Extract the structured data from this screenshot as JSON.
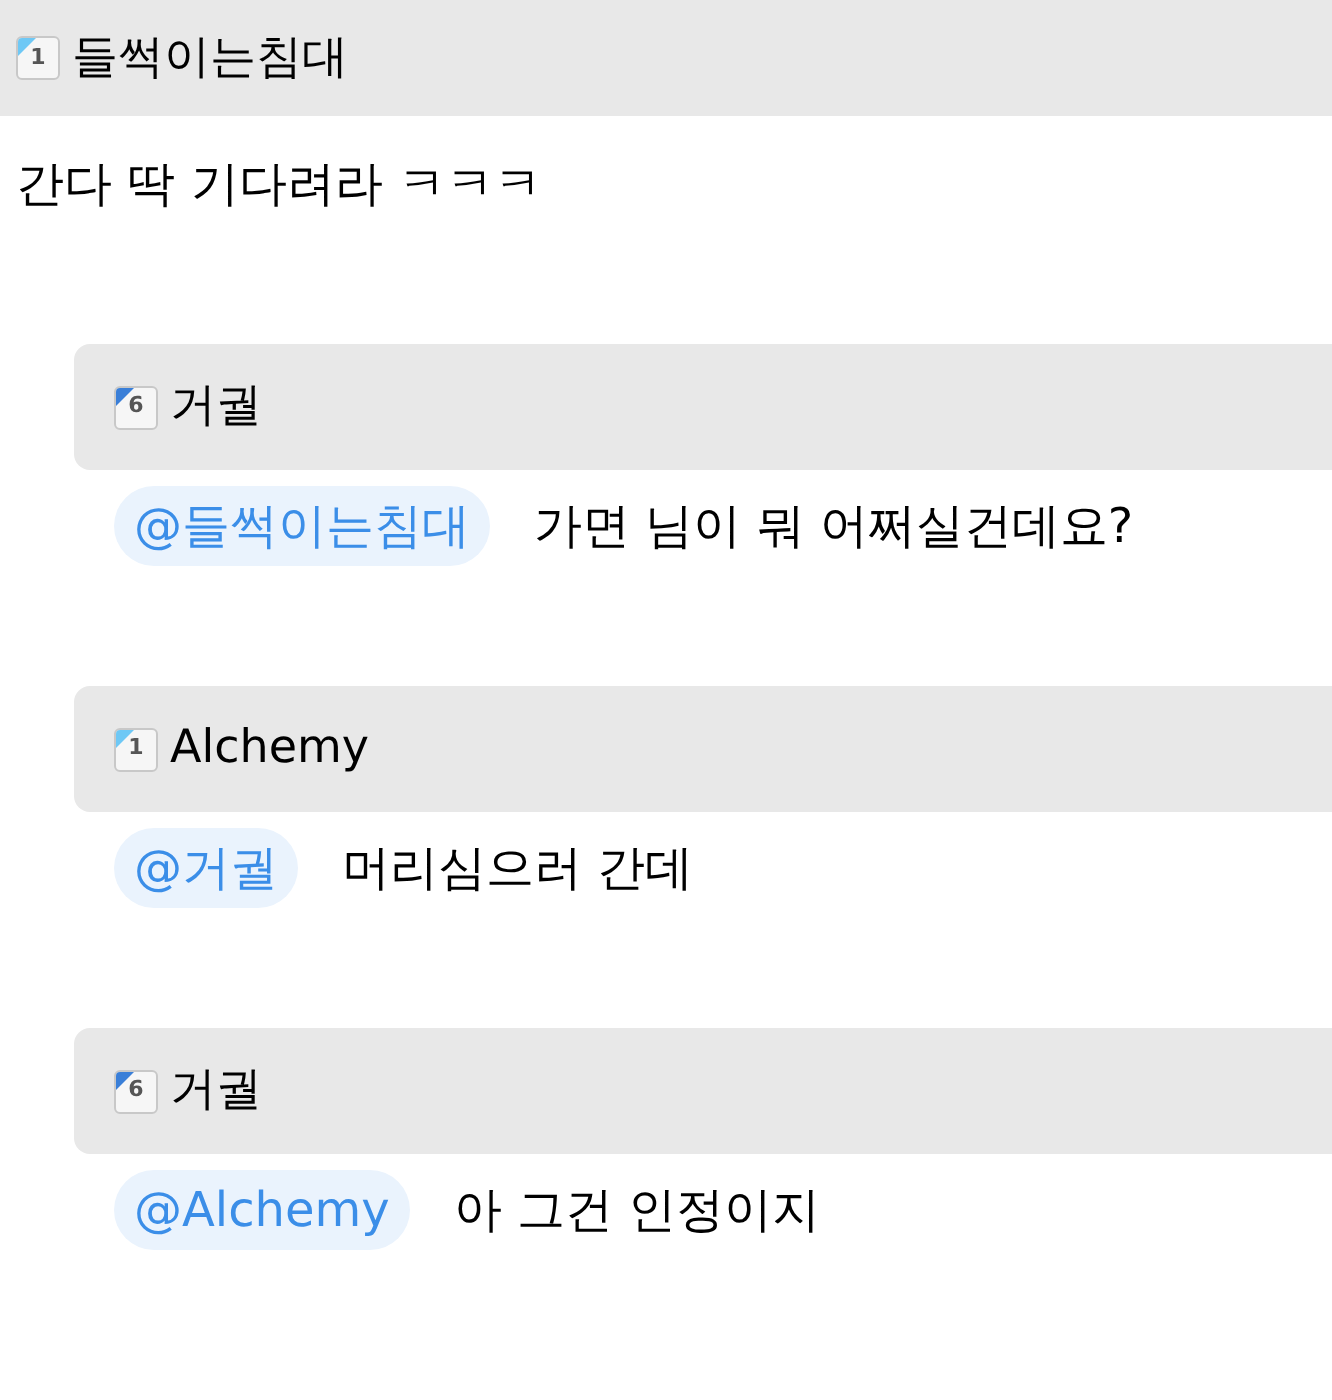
{
  "post": {
    "author": {
      "name": "들썩이는침대",
      "level": "1"
    },
    "text": "간다 딱 기다려라 ㅋㅋㅋ"
  },
  "replies": [
    {
      "author": {
        "name": "거궐",
        "level": "6"
      },
      "mention": "@들썩이는침대",
      "text": "가면 님이 뭐 어쩌실건데요?"
    },
    {
      "author": {
        "name": "Alchemy",
        "level": "1"
      },
      "mention": "@거궐",
      "text": "머리심으러 간데"
    },
    {
      "author": {
        "name": "거궐",
        "level": "6"
      },
      "mention": "@Alchemy",
      "text": "아 그건 인정이지"
    }
  ]
}
